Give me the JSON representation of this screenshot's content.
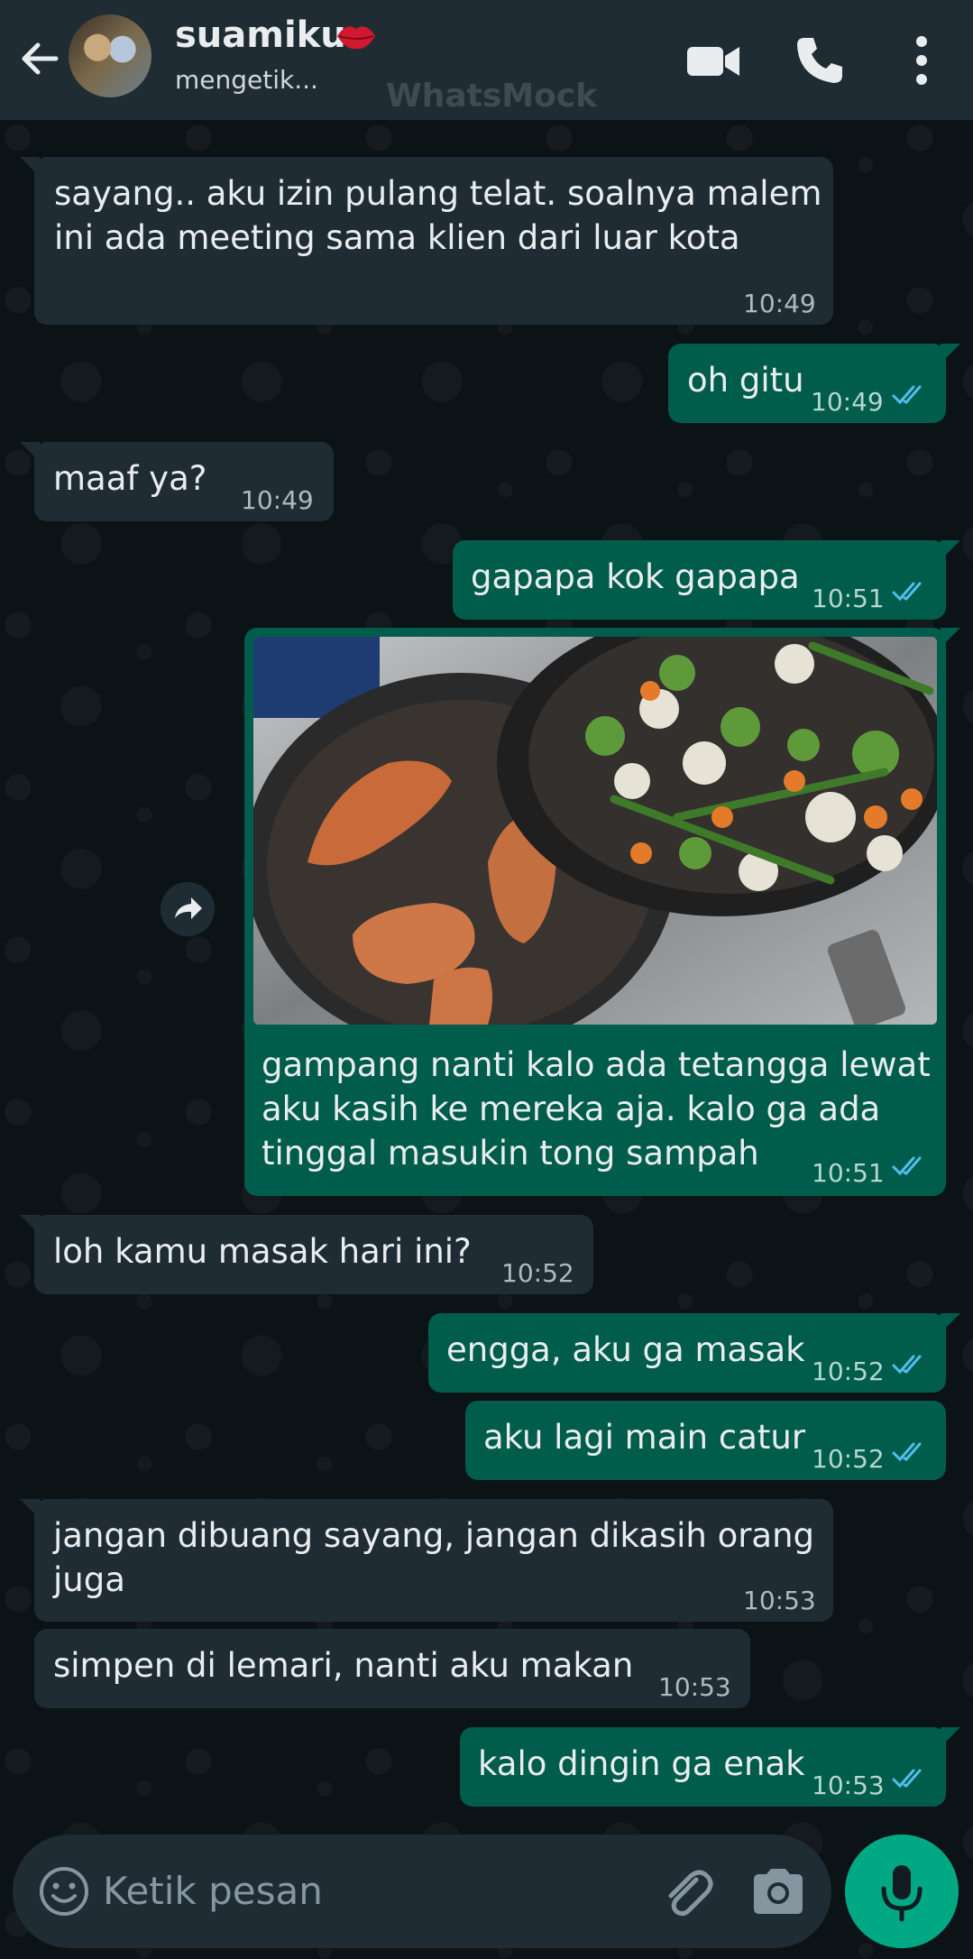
{
  "header": {
    "contact_name": "suamiku",
    "status": "mengetik...",
    "watermark": "WhatsMock",
    "icons": [
      "back-arrow-icon",
      "avatar",
      "lips-emoji-icon",
      "video-call-icon",
      "voice-call-icon",
      "more-options-icon"
    ]
  },
  "messages": [
    {
      "dir": "in",
      "text": "sayang.. aku izin pulang telat. soalnya malem\nini ada meeting sama klien dari luar kota",
      "time": "10:49"
    },
    {
      "dir": "out",
      "text": "oh gitu",
      "time": "10:49",
      "read": true
    },
    {
      "dir": "in",
      "text": "maaf ya?",
      "time": "10:49"
    },
    {
      "dir": "out",
      "text": "gapapa kok gapapa",
      "time": "10:51",
      "read": true
    },
    {
      "dir": "out",
      "image": "photo of grilled chicken breasts in a pan and stir-fried vegetables in a second pan on a stove",
      "text": "gampang nanti kalo ada tetangga lewat\naku kasih ke mereka aja. kalo ga ada\ntinggal masukin tong sampah",
      "time": "10:51",
      "read": true
    },
    {
      "dir": "in",
      "text": "loh kamu masak hari ini?",
      "time": "10:52"
    },
    {
      "dir": "out",
      "text": "engga, aku ga masak",
      "time": "10:52",
      "read": true
    },
    {
      "dir": "out",
      "text": "aku lagi main catur",
      "time": "10:52",
      "read": true
    },
    {
      "dir": "in",
      "text": "jangan dibuang sayang, jangan dikasih orang\njuga",
      "time": "10:53"
    },
    {
      "dir": "in",
      "text": "simpen di lemari, nanti aku makan",
      "time": "10:53"
    },
    {
      "dir": "out",
      "text": "kalo dingin ga enak",
      "time": "10:53",
      "read": true
    }
  ],
  "input": {
    "placeholder": "Ketik pesan"
  },
  "colors": {
    "header_bg": "#1f2c34",
    "incoming_bubble": "#1f2c34",
    "outgoing_bubble": "#005c4b",
    "read_ticks": "#53bdeb",
    "mic_button": "#00a884",
    "wallpaper": "#0c1317"
  }
}
